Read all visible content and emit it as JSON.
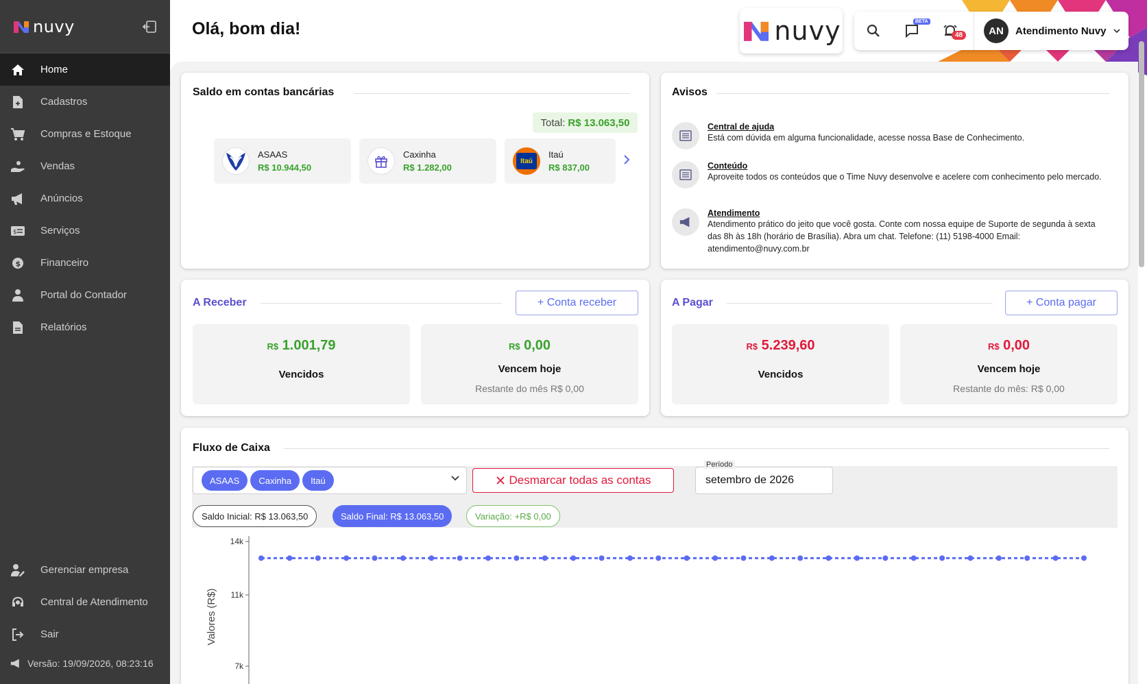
{
  "sidebar": {
    "brand": "nuvy",
    "items": [
      {
        "label": "Home",
        "icon": "home-icon",
        "active": true
      },
      {
        "label": "Cadastros",
        "icon": "file-add-icon"
      },
      {
        "label": "Compras e Estoque",
        "icon": "cart-icon"
      },
      {
        "label": "Vendas",
        "icon": "hand-coin-icon"
      },
      {
        "label": "Anúncios",
        "icon": "megaphone-icon"
      },
      {
        "label": "Serviços",
        "icon": "service-card-icon"
      },
      {
        "label": "Financeiro",
        "icon": "dollar-circle-icon"
      },
      {
        "label": "Portal do Contador",
        "icon": "accountant-icon"
      },
      {
        "label": "Relatórios",
        "icon": "report-icon"
      }
    ],
    "bottom_items": [
      {
        "label": "Gerenciar empresa",
        "icon": "user-edit-icon"
      },
      {
        "label": "Central de Atendimento",
        "icon": "headset-icon"
      },
      {
        "label": "Sair",
        "icon": "logout-icon"
      }
    ],
    "version": "Versão: 19/09/2026, 08:23:16"
  },
  "header": {
    "greeting": "Olá, bom dia!",
    "brand": "nuvy",
    "beta_badge": "BETA",
    "notification_count": "48",
    "user": {
      "initials": "AN",
      "name": "Atendimento Nuvy"
    }
  },
  "saldo": {
    "title": "Saldo em contas bancárias",
    "total_label": "Total:",
    "total_value": "R$ 13.063,50",
    "banks": [
      {
        "name": "ASAAS",
        "balance": "R$ 10.944,50"
      },
      {
        "name": "Caxinha",
        "balance": "R$ 1.282,00"
      },
      {
        "name": "Itaú",
        "balance": "R$ 837,00",
        "logo_text": "Itaú"
      }
    ]
  },
  "avisos": {
    "title": "Avisos",
    "items": [
      {
        "title": "Central de ajuda",
        "text": "Está com dúvida em alguma funcionalidade, acesse nossa Base de Conhecimento."
      },
      {
        "title": "Conteúdo",
        "text": "Aproveite todos os conteúdos que o Time Nuvy desenvolve e acelere com conhecimento pelo mercado."
      },
      {
        "title": "Atendimento",
        "text": "Atendimento prático do jeito que você gosta. Conte com nossa equipe de Suporte de segunda à sexta das 8h às 18h (horário de Brasília). Abra um chat. Telefone: (11) 5198-4000 Email: atendimento@nuvy.com.br"
      }
    ]
  },
  "receber": {
    "title": "A Receber",
    "button": "+ Conta receber",
    "vencidos": {
      "currency": "R$",
      "value": "1.001,79",
      "label": "Vencidos"
    },
    "hoje": {
      "currency": "R$",
      "value": "0,00",
      "label": "Vencem hoje",
      "sub": "Restante do mês R$ 0,00"
    }
  },
  "pagar": {
    "title": "A Pagar",
    "button": "+ Conta pagar",
    "vencidos": {
      "currency": "R$",
      "value": "5.239,60",
      "label": "Vencidos"
    },
    "hoje": {
      "currency": "R$",
      "value": "0,00",
      "label": "Vencem hoje",
      "sub": "Restante do mês: R$ 0,00"
    }
  },
  "fluxo": {
    "title": "Fluxo de Caixa",
    "selected_accounts": [
      "ASAAS",
      "Caxinha",
      "Itaú"
    ],
    "clear_button": "Desmarcar todas as contas",
    "periodo_label": "Período",
    "periodo_value": "setembro de 2026",
    "saldo_inicial": "Saldo Inicial: R$ 13.063,50",
    "saldo_final": "Saldo Final: R$ 13.063,50",
    "variacao": "Variação: +R$ 0,00"
  },
  "colors": {
    "accent": "#5b6cf2",
    "green": "#3aa22c",
    "red": "#e0193a",
    "sidebar": "#3a3a3a"
  },
  "chart_data": {
    "type": "line",
    "ylabel": "Valores (R$)",
    "y_ticks": [
      "14k",
      "11k",
      "7k"
    ],
    "y_tick_values": [
      14000,
      11000,
      7000
    ],
    "ylim": [
      7000,
      14000
    ],
    "series": [
      {
        "values": [
          13063.5,
          13063.5,
          13063.5,
          13063.5,
          13063.5,
          13063.5,
          13063.5,
          13063.5,
          13063.5,
          13063.5,
          13063.5,
          13063.5,
          13063.5,
          13063.5,
          13063.5,
          13063.5,
          13063.5,
          13063.5,
          13063.5,
          13063.5,
          13063.5,
          13063.5,
          13063.5,
          13063.5,
          13063.5,
          13063.5,
          13063.5,
          13063.5,
          13063.5,
          13063.5
        ]
      }
    ],
    "color": "#5b6cf2",
    "grid": false
  }
}
